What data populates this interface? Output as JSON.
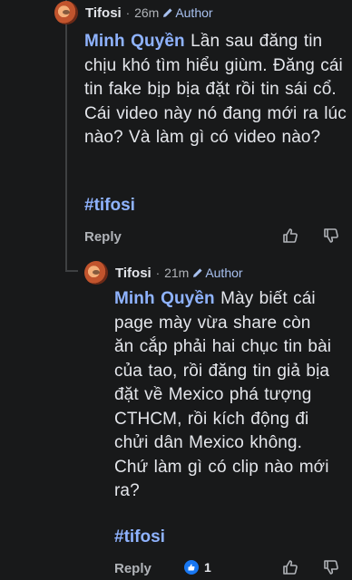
{
  "comments": [
    {
      "author": "Tifosi",
      "time": "26m",
      "badge": "Author",
      "mention": "Minh Quyền",
      "text": " Lần sau đăng tin chịu khó tìm hiểu giùm. Đăng cái tin fake bịp bịa đặt rồi tin sái cổ. Cái video này nó đang mới ra lúc nào? Và làm gì có video nào?",
      "hashtag": "#tifosi",
      "reply_label": "Reply"
    },
    {
      "author": "Tifosi",
      "time": "21m",
      "badge": "Author",
      "mention": "Minh Quyền",
      "text": " Mày biết cái page mày vừa share còn ăn cắp phải hai chục tin bài của tao, rồi đăng tin giả bịa đặt về Mexico phá tượng CTHCM, rồi kích động đi chửi dân Mexico không. Chứ làm gì có clip nào mới ra?",
      "hashtag": "#tifosi",
      "reply_label": "Reply",
      "reaction_count": "1"
    }
  ],
  "icons": {
    "like": "thumbs-up-icon",
    "dislike": "thumbs-down-icon",
    "edit": "pencil-icon"
  },
  "colors": {
    "background": "#18191a",
    "text": "#e4e6eb",
    "muted": "#b0b3b8",
    "accent": "#8fb3ff",
    "like_badge": "#1877f2"
  }
}
